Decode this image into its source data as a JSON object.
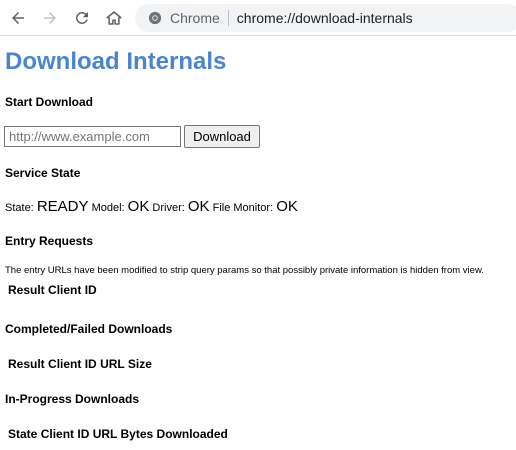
{
  "toolbar": {
    "back_icon": "arrow-left-icon",
    "forward_icon": "arrow-right-icon",
    "reload_icon": "reload-icon",
    "home_icon": "home-icon",
    "origin_label": "Chrome",
    "url": "chrome://download-internals"
  },
  "page": {
    "title": "Download Internals",
    "start_download": {
      "heading": "Start Download",
      "url_placeholder": "http://www.example.com",
      "url_value": "",
      "button_label": "Download"
    },
    "service_state": {
      "heading": "Service State",
      "state_label": "State:",
      "state_value": "READY",
      "model_label": "Model:",
      "model_value": "OK",
      "driver_label": "Driver:",
      "driver_value": "OK",
      "file_monitor_label": "File Monitor:",
      "file_monitor_value": "OK"
    },
    "entry_requests": {
      "heading": "Entry Requests",
      "note": "The entry URLs have been modified to strip query params so that possibly private information is hidden from view.",
      "columns": [
        "Result",
        "Client",
        "ID"
      ]
    },
    "completed_downloads": {
      "heading": "Completed/Failed Downloads",
      "columns": [
        "Result",
        "Client",
        "ID",
        "URL",
        "Size"
      ]
    },
    "in_progress_downloads": {
      "heading": "In-Progress Downloads",
      "columns": [
        "State",
        "Client",
        "ID",
        "URL",
        "Bytes Downloaded"
      ]
    }
  },
  "colors": {
    "title": "#4a86cf",
    "omnibox_bg": "#f1f3f4"
  }
}
